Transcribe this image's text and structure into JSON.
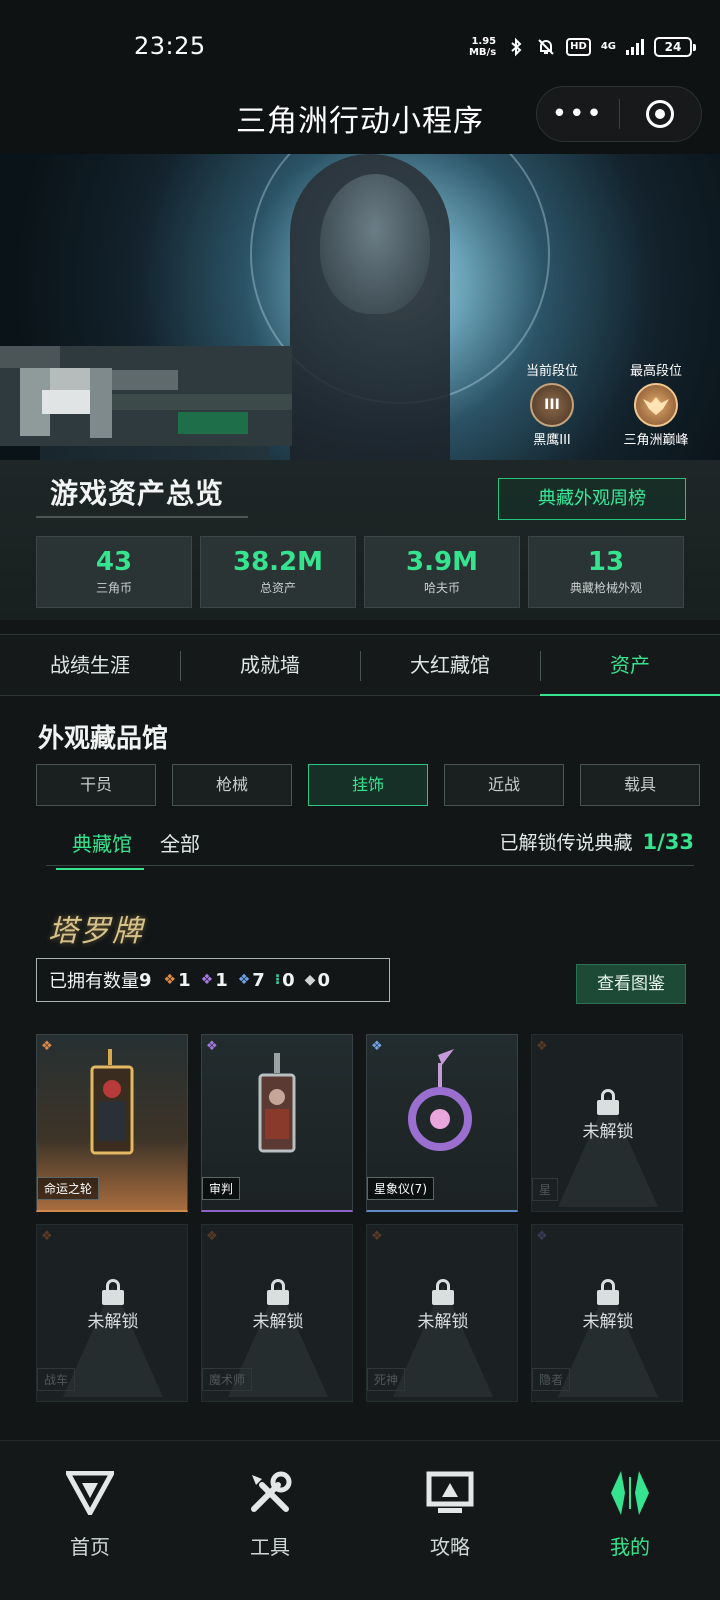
{
  "status_bar": {
    "time": "23:25",
    "net_speed_top": "1.95",
    "net_speed_bottom": "MB/s",
    "hd": "HD",
    "signal": "4G",
    "battery": "24"
  },
  "navbar": {
    "title": "三角洲行动小程序",
    "more": "•••"
  },
  "banner": {
    "current_rank_label": "当前段位",
    "current_rank_name": "黑鹰III",
    "current_rank_badge": "III",
    "highest_rank_label": "最高段位",
    "highest_rank_name": "三角洲巅峰"
  },
  "overview": {
    "title": "游戏资产总览",
    "weekly_button": "典藏外观周榜",
    "stats": [
      {
        "value": "43",
        "label": "三角币"
      },
      {
        "value": "38.2M",
        "label": "总资产"
      },
      {
        "value": "3.9M",
        "label": "哈夫币"
      },
      {
        "value": "13",
        "label": "典藏枪械外观"
      }
    ]
  },
  "tabs": [
    "战绩生涯",
    "成就墙",
    "大红藏馆",
    "资产"
  ],
  "collection": {
    "title": "外观藏品馆",
    "filters": [
      "干员",
      "枪械",
      "挂饰",
      "近战",
      "载具"
    ],
    "subtab_collection": "典藏馆",
    "subtab_all": "全部",
    "unlock_label": "已解锁传说典藏",
    "unlock_value": "1/33",
    "series_logo": "塔罗牌",
    "owned_label": "已拥有数量",
    "owned_total": "9",
    "owned_counts": [
      "1",
      "1",
      "7",
      "0",
      "0"
    ],
    "view_button": "查看图鉴",
    "locked_text": "未解锁",
    "items": [
      {
        "name": "命运之轮"
      },
      {
        "name": "审判"
      },
      {
        "name": "星象仪(7)"
      },
      {
        "name": "星"
      },
      {
        "name": "战车"
      },
      {
        "name": "魔术师"
      },
      {
        "name": "死神"
      },
      {
        "name": "隐者"
      }
    ]
  },
  "bottom_nav": [
    "首页",
    "工具",
    "攻略",
    "我的"
  ],
  "colors": {
    "accent": "#36e38e",
    "gold": "#d38a4d",
    "purple": "#8e63c7",
    "blue": "#5f89c9"
  }
}
